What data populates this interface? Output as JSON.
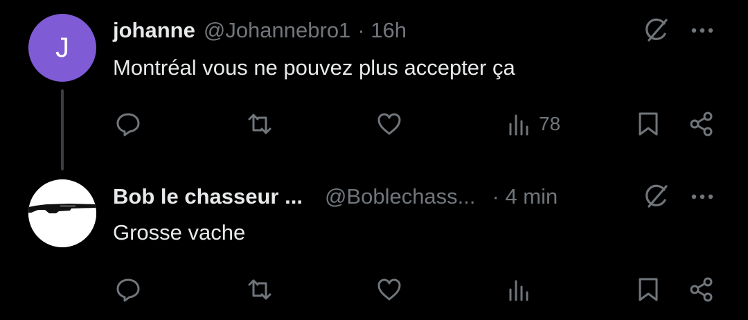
{
  "tweets": [
    {
      "avatar_letter": "J",
      "avatar_color": "#7f5bd5",
      "display_name": "johanne",
      "handle": "@Johannebro1",
      "time": "· 16h",
      "text": "Montréal vous ne pouvez plus accepter ça",
      "views": "78"
    },
    {
      "avatar_image": "shotgun",
      "display_name": "Bob le chasseur ...",
      "handle": "@Boblechass...",
      "time": "· 4 min",
      "text": "Grosse vache"
    }
  ],
  "icons": {
    "reply": "reply-icon",
    "retweet": "retweet-icon",
    "like": "heart-icon",
    "views": "views-icon",
    "bookmark": "bookmark-icon",
    "share": "share-icon",
    "grok": "grok-icon",
    "more": "more-icon"
  },
  "colors": {
    "background": "#000000",
    "text": "#e7e9ea",
    "muted": "#71767b",
    "thread_line": "#3a3d41"
  }
}
